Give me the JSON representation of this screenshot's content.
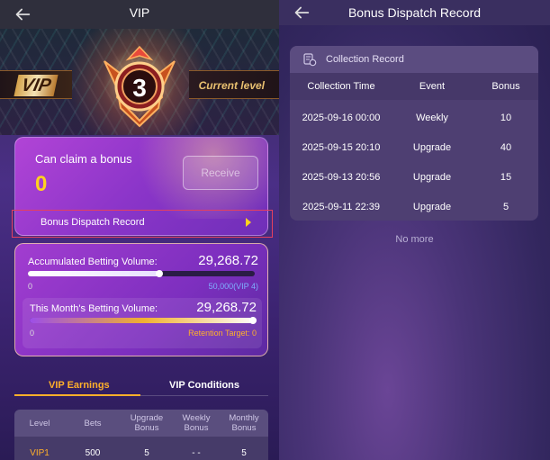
{
  "left": {
    "title": "VIP",
    "vip_logo": "VIP",
    "level_number": "3",
    "current_level_label": "Current level",
    "claim": {
      "title": "Can claim a bonus",
      "amount": "0",
      "receive_label": "Receive"
    },
    "dispatch_label": "Bonus Dispatch Record",
    "accumulated": {
      "label": "Accumulated Betting Volume:",
      "value": "29,268.72",
      "min": "0",
      "max": "50,000(VIP 4)",
      "progress": 0.58
    },
    "monthly": {
      "label": "This Month's Betting Volume:",
      "value": "29,268.72",
      "min": "0",
      "max": "Retention Target: 0",
      "progress": 1.0
    },
    "tabs": [
      {
        "label": "VIP Earnings",
        "active": true
      },
      {
        "label": "VIP Conditions",
        "active": false
      }
    ],
    "table": {
      "headers": [
        "Level",
        "Bets",
        "Upgrade Bonus",
        "Weekly Bonus",
        "Monthly Bonus"
      ],
      "row": [
        "VIP1",
        "500",
        "5",
        "- -",
        "5"
      ]
    }
  },
  "right": {
    "title": "Bonus Dispatch Record",
    "card_title": "Collection Record",
    "columns": [
      "Collection Time",
      "Event",
      "Bonus"
    ],
    "rows": [
      [
        "2025-09-16 00:00",
        "Weekly",
        "10"
      ],
      [
        "2025-09-15 20:10",
        "Upgrade",
        "40"
      ],
      [
        "2025-09-13 20:56",
        "Upgrade",
        "15"
      ],
      [
        "2025-09-11 22:39",
        "Upgrade",
        "5"
      ]
    ],
    "no_more": "No more"
  },
  "colors": {
    "accent": "#ffb02a",
    "gold": "#ffd21f",
    "highlight_outline": "#e44060"
  },
  "icons": {
    "back": "arrow-left-icon",
    "dispatch_arrow": "triangle-right-icon",
    "record": "coin-stack-icon",
    "level_badge": "winged-shield-badge-icon"
  }
}
